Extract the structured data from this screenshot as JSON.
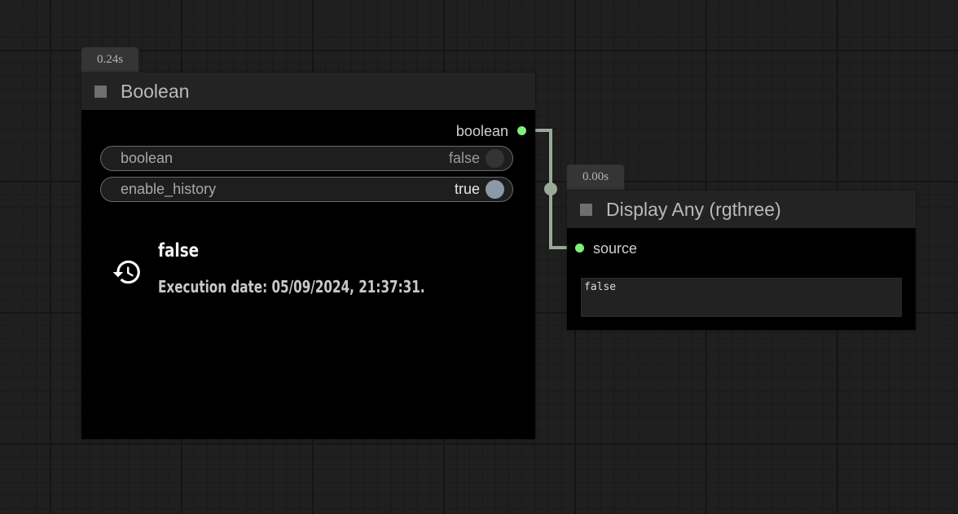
{
  "nodes": {
    "boolean": {
      "time": "0.24s",
      "title": "Boolean",
      "output_label": "boolean",
      "widgets": [
        {
          "name": "boolean",
          "value": "false",
          "state": "off"
        },
        {
          "name": "enable_history",
          "value": "true",
          "state": "on"
        }
      ],
      "history": {
        "icon": "history-icon",
        "value": "false",
        "date": "Execution date: 05/09/2024, 21:37:31."
      }
    },
    "display": {
      "time": "0.00s",
      "title": "Display Any (rgthree)",
      "input_label": "source",
      "text": "false"
    }
  },
  "colors": {
    "canvas": "#1f1f1f",
    "node_body": "#000000",
    "node_header": "#232323",
    "slot_boolean": "#7ef07a",
    "link": "#9aaa9a",
    "toggle_on": "#8c9aa8"
  }
}
